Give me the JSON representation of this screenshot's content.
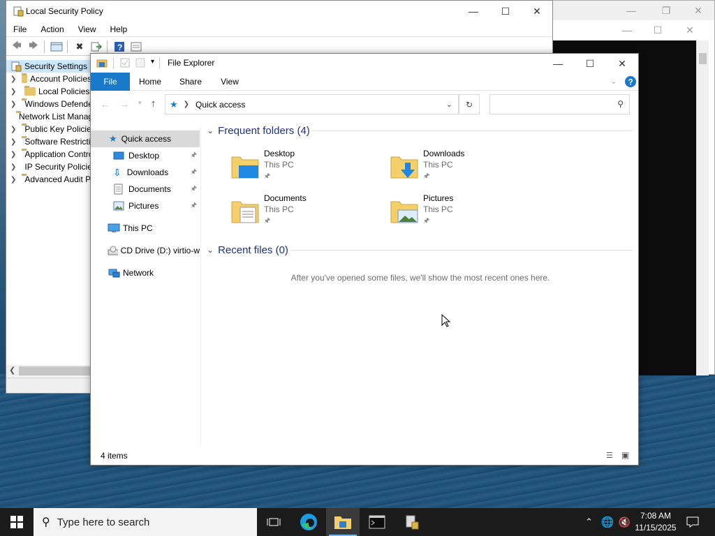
{
  "lsp": {
    "title": "Local Security Policy",
    "menu": [
      "File",
      "Action",
      "View",
      "Help"
    ],
    "tree": [
      {
        "label": "Security Settings"
      },
      {
        "label": "Account Policies"
      },
      {
        "label": "Local Policies"
      },
      {
        "label": "Windows Defender Firewall with Advanced Security"
      },
      {
        "label": "Network List Manager Policies"
      },
      {
        "label": "Public Key Policies"
      },
      {
        "label": "Software Restriction Policies"
      },
      {
        "label": "Application Control Policies"
      },
      {
        "label": "IP Security Policies on Local Computer"
      },
      {
        "label": "Advanced Audit Policy Configuration"
      }
    ]
  },
  "explorer": {
    "title": "File Explorer",
    "tabs": {
      "file": "File",
      "home": "Home",
      "share": "Share",
      "view": "View"
    },
    "address": "Quick access",
    "search_placeholder": "",
    "nav": {
      "quick_access": "Quick access",
      "desktop": "Desktop",
      "downloads": "Downloads",
      "documents": "Documents",
      "pictures": "Pictures",
      "this_pc": "This PC",
      "cd_drive": "CD Drive (D:) virtio-w",
      "network": "Network"
    },
    "frequent_header": "Frequent folders (4)",
    "recent_header": "Recent files (0)",
    "folders": [
      {
        "name": "Desktop",
        "location": "This PC"
      },
      {
        "name": "Downloads",
        "location": "This PC"
      },
      {
        "name": "Documents",
        "location": "This PC"
      },
      {
        "name": "Pictures",
        "location": "This PC"
      }
    ],
    "empty_message": "After you've opened some files, we'll show the most recent ones here.",
    "status": "4 items"
  },
  "taskbar": {
    "search_placeholder": "Type here to search",
    "time": "7:08 AM",
    "date": "11/15/2025"
  },
  "colors": {
    "accent": "#1979ca",
    "group_header": "#1e3287",
    "selection": "#cce8ff"
  }
}
